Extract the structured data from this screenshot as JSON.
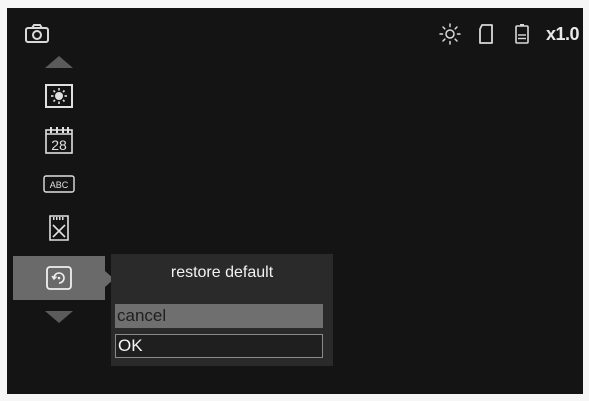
{
  "status_bar": {
    "left_icon": "camera-icon",
    "icons": [
      "brightness-icon",
      "sd-card-icon",
      "battery-icon"
    ],
    "zoom": "x1.0"
  },
  "menu": {
    "items": [
      {
        "icon": "brightness-icon"
      },
      {
        "icon": "calendar-icon",
        "label": "28"
      },
      {
        "icon": "abc-icon",
        "label": "ABC"
      },
      {
        "icon": "format-sd-icon"
      },
      {
        "icon": "restore-icon",
        "selected": true
      }
    ]
  },
  "dialog": {
    "title": "restore default",
    "cancel_label": "cancel",
    "ok_label": "OK"
  }
}
